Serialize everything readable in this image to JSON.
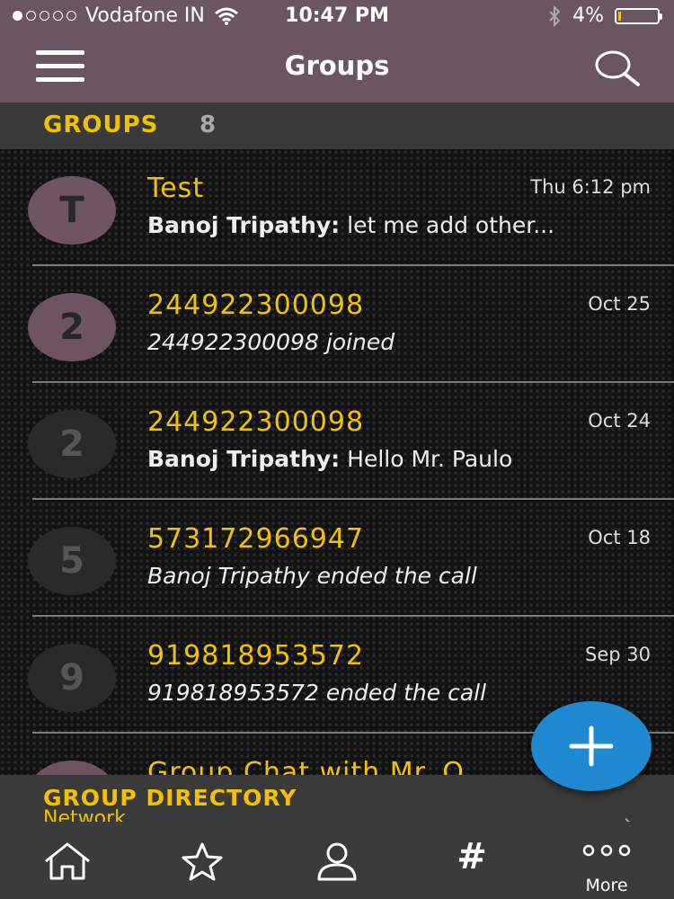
{
  "status_bar": {
    "carrier": "Vodafone IN",
    "time": "10:47 PM",
    "battery": "4%"
  },
  "header": {
    "title": "Groups"
  },
  "groups_section": {
    "label": "GROUPS",
    "count": "8"
  },
  "groups": [
    {
      "avatar": "T",
      "name": "Test",
      "date": "Thu 6:12 pm",
      "sender": "Banoj Tripathy:",
      "message": "let me add other..."
    },
    {
      "avatar": "2",
      "name": "244922300098",
      "date": "Oct 25",
      "sender": "",
      "message": "244922300098 joined"
    },
    {
      "avatar": "2",
      "name": "244922300098",
      "date": "Oct 24",
      "sender": "Banoj Tripathy:",
      "message": "Hello Mr. Paulo"
    },
    {
      "avatar": "5",
      "name": "573172966947",
      "date": "Oct 18",
      "sender": "",
      "message": "Banoj Tripathy ended the call"
    },
    {
      "avatar": "9",
      "name": "919818953572",
      "date": "Sep 30",
      "sender": "",
      "message": "919818953572 ended the call"
    },
    {
      "avatar": "",
      "name": "Group Chat with Mr. Q",
      "date": "",
      "sender": "",
      "message": ""
    }
  ],
  "directory": {
    "label": "GROUP DIRECTORY",
    "sublabel": "Network"
  },
  "tabbar": {
    "hash": "#",
    "more_dots": "○○○",
    "more_label": "More"
  },
  "colors": {
    "accent": "#f2c200",
    "header_bg": "#6b5562",
    "fab": "#1e88d0"
  },
  "icons": [
    "menu-icon",
    "search-icon",
    "wifi-icon",
    "bluetooth-icon",
    "battery-icon",
    "plus-icon",
    "home-icon",
    "star-icon",
    "person-icon",
    "hash-icon",
    "more-icon",
    "chevron-right-icon"
  ]
}
